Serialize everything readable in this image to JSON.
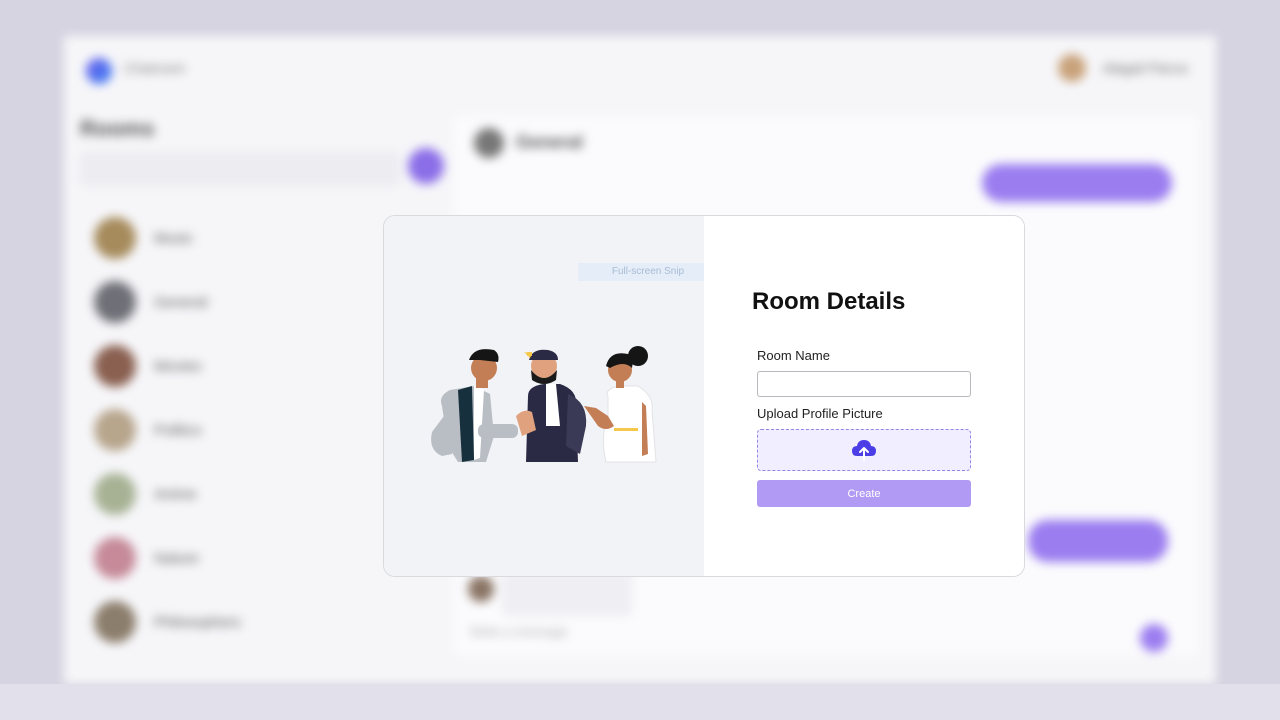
{
  "modal": {
    "title": "Room Details",
    "room_name_label": "Room Name",
    "room_name_value": "",
    "upload_label": "Upload Profile Picture",
    "upload_icon": "cloud-upload-icon",
    "create_label": "Create",
    "accent_color": "#b19af3",
    "upload_icon_color": "#4b3ee6",
    "snip_hint": "Full-screen Snip"
  },
  "background": {
    "brand": "Chatroom",
    "user_name": "Abigail Pierce",
    "rooms_title": "Rooms",
    "rooms": [
      "Music",
      "General",
      "Movies",
      "Politics",
      "Anime",
      "Nature",
      "Philosophers"
    ],
    "chat_title": "General",
    "message_placeholder": "Write a message"
  }
}
